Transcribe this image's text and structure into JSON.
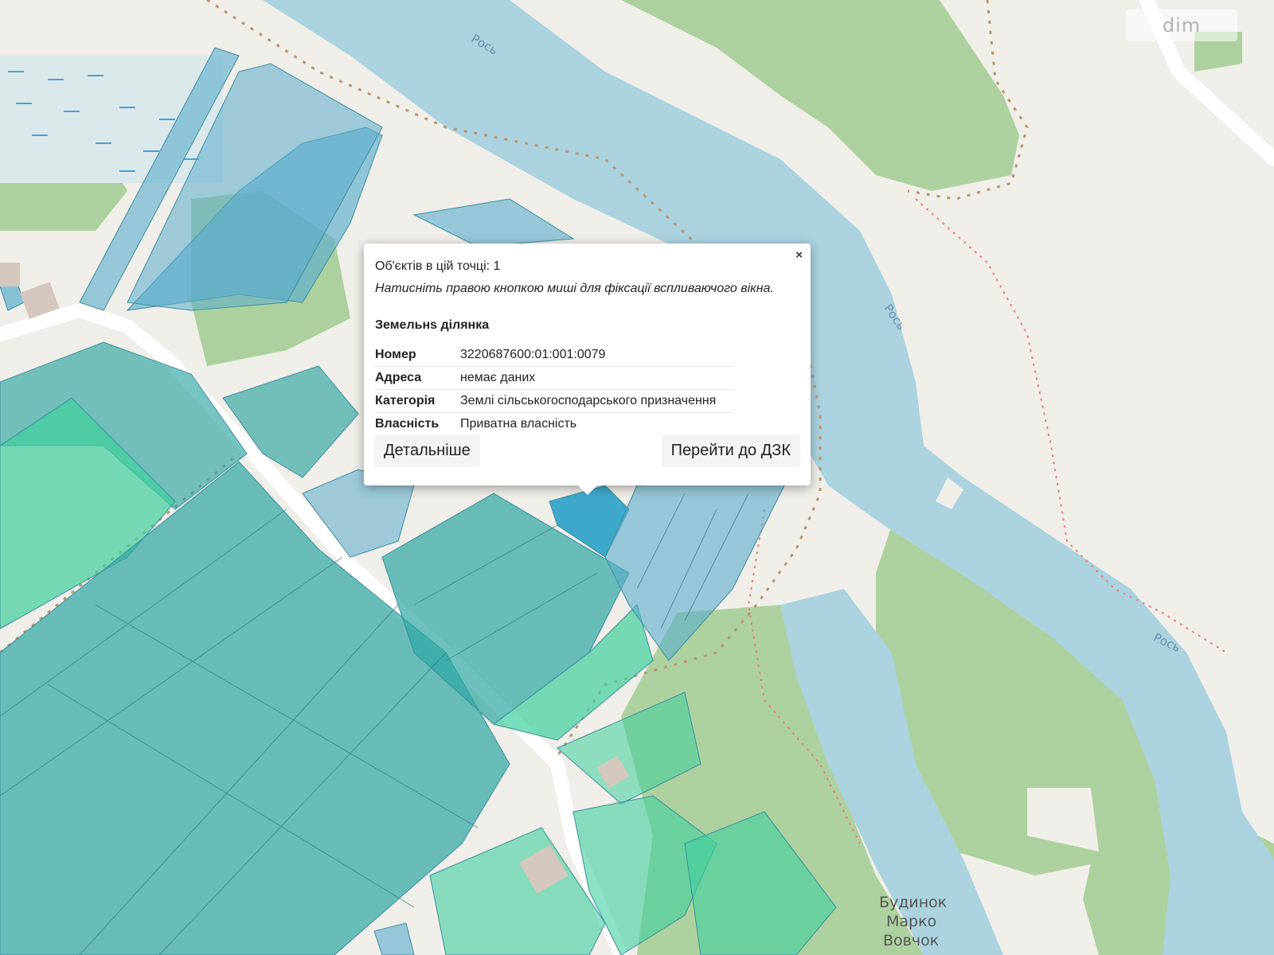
{
  "map": {
    "labels": {
      "river_top": "Рось",
      "river_middle": "Рось",
      "river_right": "Рось",
      "place_line1": "Будинок",
      "place_line2": "Марко",
      "place_line3": "Вовчок"
    },
    "watermark": "dim",
    "colors": {
      "background": "#f0eee8",
      "river": "#aad3df",
      "forest": "#add19e",
      "parcel_blue": "#5aaccc",
      "parcel_teal": "#2ea6a2",
      "parcel_green": "#3ecf9c",
      "selected_parcel": "#2aa0c8",
      "road": "#ffffff",
      "trail": "#b8956e",
      "border": "#e87d7d"
    }
  },
  "popup": {
    "count_text": "Об'єктів в цій точці: 1",
    "hint_text": "Натисніть правою кнопкою миші для фіксації вспливаючого вікна.",
    "close_label": "×",
    "title": "Земельнs ділянка",
    "rows": [
      {
        "key": "Номер",
        "value": "3220687600:01:001:0079"
      },
      {
        "key": "Адреса",
        "value": "немає даних"
      },
      {
        "key": "Категорія",
        "value": "Землі сільськогосподарського призначення"
      },
      {
        "key": "Власність",
        "value": "Приватна власність"
      }
    ],
    "details_button": "Детальніше",
    "dzk_button": "Перейти до ДЗК"
  }
}
